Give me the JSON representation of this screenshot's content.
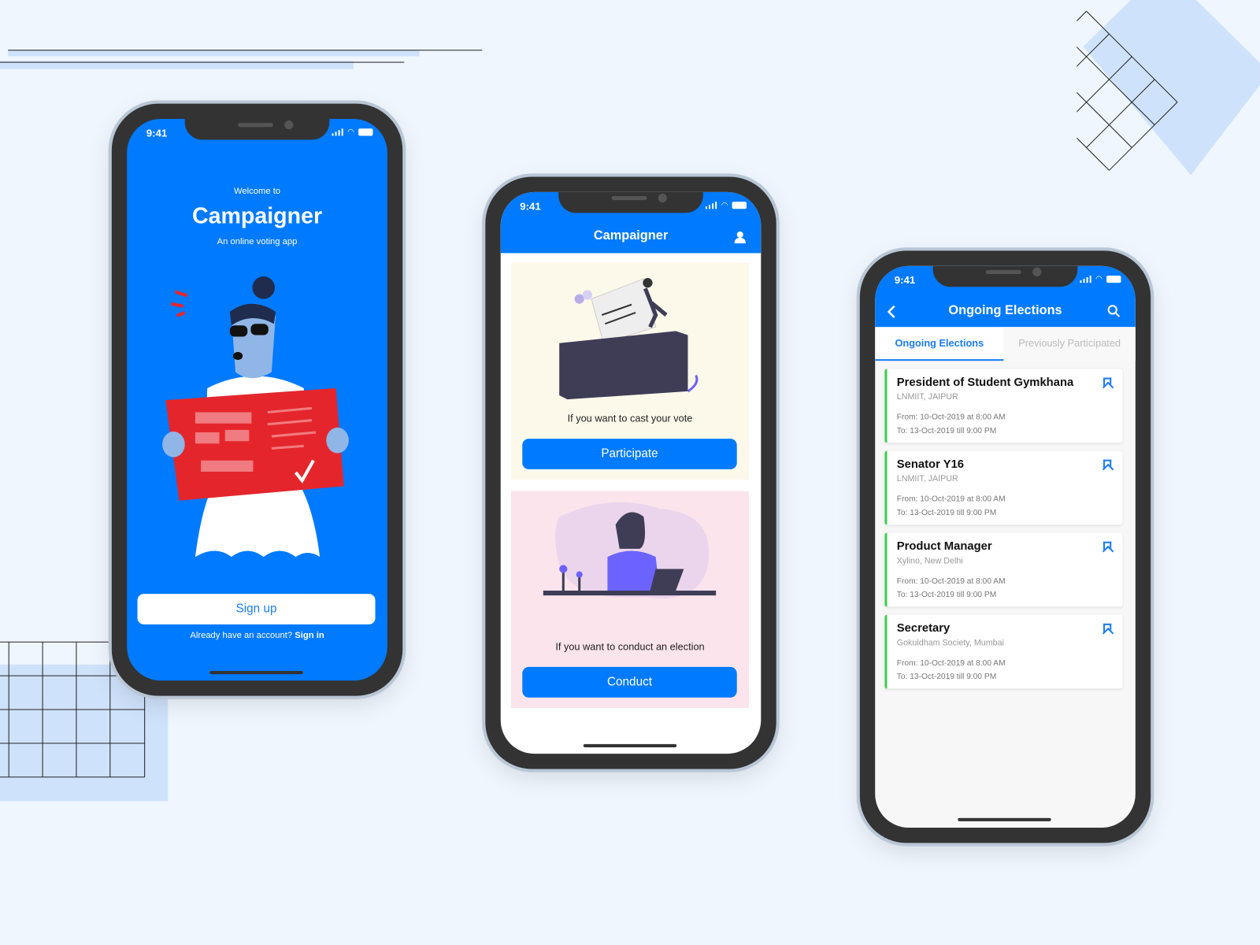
{
  "colors": {
    "primary": "#007aff",
    "background": "#eff6fe",
    "active_card_border": "#3ccf4e"
  },
  "status_bar": {
    "time": "9:41"
  },
  "welcome_screen": {
    "welcome": "Welcome to",
    "title": "Campaigner",
    "subtitle": "An online voting app",
    "signup_label": "Sign up",
    "signin_prompt": "Already have an account?",
    "signin_label": "Sign in"
  },
  "home_screen": {
    "title": "Campaigner",
    "profile_icon": "user-icon",
    "vote_caption": "If you want to cast your vote",
    "participate_label": "Participate",
    "conduct_caption": "If you want to conduct an election",
    "conduct_label": "Conduct"
  },
  "elections_screen": {
    "title": "Ongoing Elections",
    "back_icon": "chevron-left-icon",
    "search_icon": "search-icon",
    "tabs": [
      {
        "label": "Ongoing Elections",
        "active": true
      },
      {
        "label": "Previously Participated",
        "active": false
      }
    ],
    "elections": [
      {
        "title": "President of Student Gymkhana",
        "org": "LNMIIT, JAIPUR",
        "from": "From: 10-Oct-2019  at 8:00 AM",
        "to": "To: 13-Oct-2019  till 9:00 PM"
      },
      {
        "title": "Senator Y16",
        "org": "LNMIIT, JAIPUR",
        "from": "From: 10-Oct-2019  at 8:00 AM",
        "to": "To: 13-Oct-2019  till 9:00 PM"
      },
      {
        "title": "Product Manager",
        "org": "Xylino, New Delhi",
        "from": "From: 10-Oct-2019  at 8:00 AM",
        "to": "To: 13-Oct-2019  till 9:00 PM"
      },
      {
        "title": "Secretary",
        "org": "Gokuldham Society, Mumbai",
        "from": "From: 10-Oct-2019  at 8:00 AM",
        "to": "To: 13-Oct-2019  till 9:00 PM"
      }
    ]
  }
}
